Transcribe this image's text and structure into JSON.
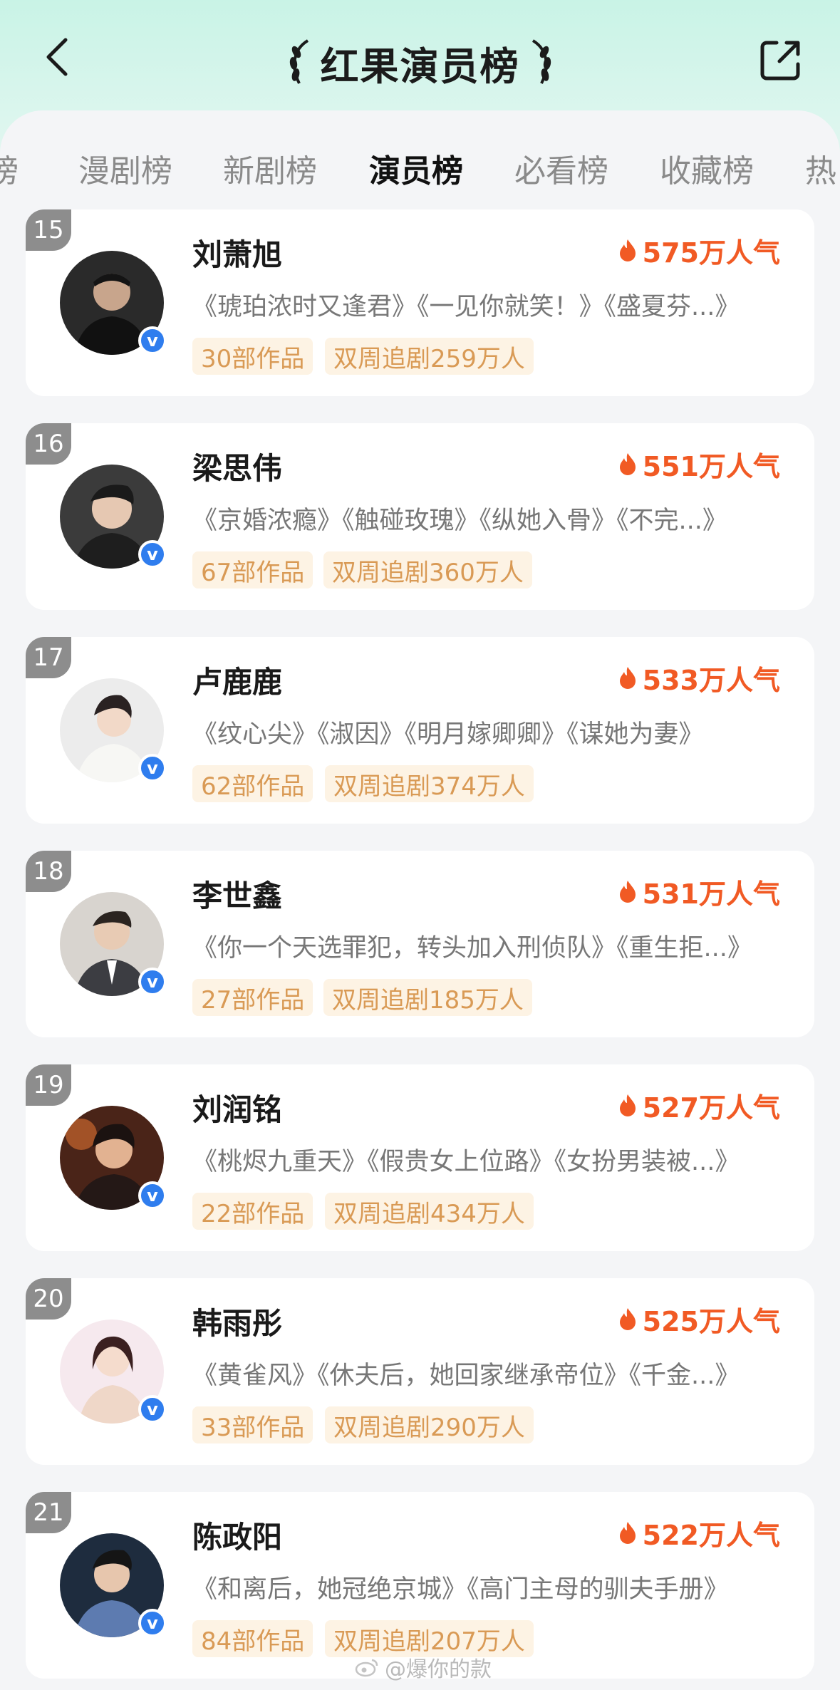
{
  "header": {
    "title": "红果演员榜",
    "colors": {
      "accent": "#f15a24",
      "tag_text": "#d99a55",
      "tag_bg": "#fdf3e4"
    }
  },
  "tabs": [
    {
      "label": "榜"
    },
    {
      "label": "漫剧榜"
    },
    {
      "label": "新剧榜"
    },
    {
      "label": "演员榜",
      "active": true
    },
    {
      "label": "必看榜"
    },
    {
      "label": "收藏榜"
    },
    {
      "label": "热"
    }
  ],
  "actors": [
    {
      "rank": "15",
      "name": "刘萧旭",
      "popularity": "575万人气",
      "works": "《琥珀浓时又逢君》《一见你就笑！》《盛夏芬...》",
      "works_count": "30部作品",
      "followers": "双周追剧259万人"
    },
    {
      "rank": "16",
      "name": "梁思伟",
      "popularity": "551万人气",
      "works": "《京婚浓瘾》《触碰玫瑰》《纵她入骨》《不完...》",
      "works_count": "67部作品",
      "followers": "双周追剧360万人"
    },
    {
      "rank": "17",
      "name": "卢鹿鹿",
      "popularity": "533万人气",
      "works": "《纹心尖》《淑因》《明月嫁卿卿》《谋她为妻》",
      "works_count": "62部作品",
      "followers": "双周追剧374万人"
    },
    {
      "rank": "18",
      "name": "李世鑫",
      "popularity": "531万人气",
      "works": "《你一个天选罪犯，转头加入刑侦队》《重生拒...》",
      "works_count": "27部作品",
      "followers": "双周追剧185万人"
    },
    {
      "rank": "19",
      "name": "刘润铭",
      "popularity": "527万人气",
      "works": "《桃烬九重天》《假贵女上位路》《女扮男装被...》",
      "works_count": "22部作品",
      "followers": "双周追剧434万人"
    },
    {
      "rank": "20",
      "name": "韩雨彤",
      "popularity": "525万人气",
      "works": "《黄雀风》《休夫后，她回家继承帝位》《千金...》",
      "works_count": "33部作品",
      "followers": "双周追剧290万人"
    },
    {
      "rank": "21",
      "name": "陈政阳",
      "popularity": "522万人气",
      "works": "《和离后，她冠绝京城》《高门主母的驯夫手册》",
      "works_count": "84部作品",
      "followers": "双周追剧207万人"
    }
  ],
  "verified_mark": "v",
  "watermark": "@爆你的款"
}
